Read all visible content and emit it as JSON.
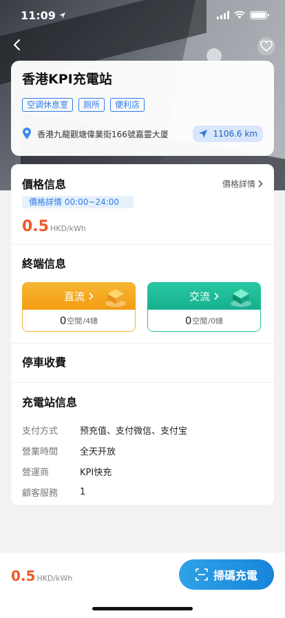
{
  "status": {
    "time": "11:09"
  },
  "station": {
    "name": "香港KPI充電站",
    "tags": [
      "空调休息室",
      "厕所",
      "便利店"
    ],
    "address": "香港九龍觀塘偉業街166號嘉靈大厦",
    "distance": "1106.6 km"
  },
  "price": {
    "title": "價格信息",
    "detail_link": "價格詳情",
    "period": "價格詳情 00:00~24:00",
    "value": "0.5",
    "unit": "HKD/kWh"
  },
  "terminals": {
    "title": "終端信息",
    "dc": {
      "label": "直流",
      "free": "0",
      "free_label": "空閒",
      "total": "/4總"
    },
    "ac": {
      "label": "交流",
      "free": "0",
      "free_label": "空閒",
      "total": "/0總"
    }
  },
  "parking": {
    "title": "停車收費"
  },
  "info": {
    "title": "充電站信息",
    "rows": [
      {
        "k": "支付方式",
        "v": "预充值、支付微信、支付宝"
      },
      {
        "k": "營業時間",
        "v": "全天开放"
      },
      {
        "k": "營運商",
        "v": "KPI快充"
      },
      {
        "k": "顧客服務",
        "v": "1"
      }
    ]
  },
  "bottom": {
    "price": "0.5",
    "unit": "HKD/kWh",
    "scan_label": "掃碼充電"
  }
}
